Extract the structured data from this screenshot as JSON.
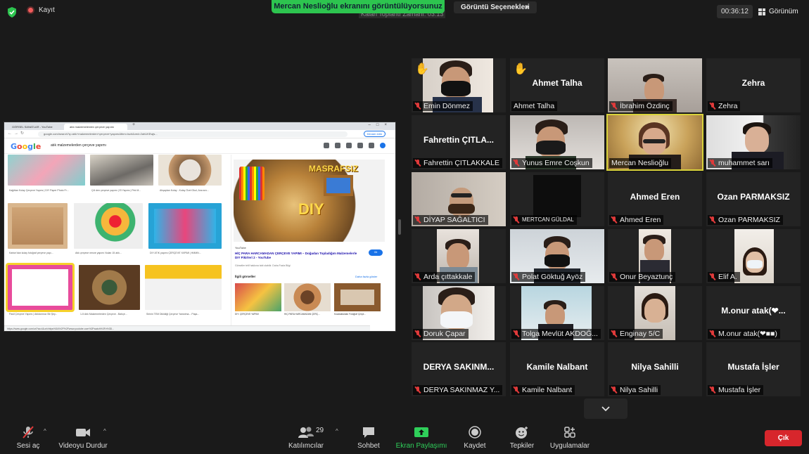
{
  "topbar": {
    "record_label": "Kayıt",
    "share_banner": "Mercan Neslioğlu ekranını görüntülüyorsunuz",
    "remaining_time": "Kalan Toplantı Zamanı: 03:13",
    "view_options_label": "Görüntü Seçenekleri",
    "timer": "00:36:12",
    "view_label": "Görünüm"
  },
  "shared_screen": {
    "browser_tabs": [
      "GÖRSEL SANATLAR - YouTube",
      "atık malzemelerden çerçeve yapımı"
    ],
    "url": "google.com/search?q=atık+malzemelerden+çerçeve+yapımı&tbm=isch&ved=2ahUKEwjs...",
    "continue_label": "Devam edin",
    "google_logo": "Google",
    "search_query": "atık malzemelerden çerçeve yapımı",
    "thumb_captions": [
      "Kağıttan Kolay Çerçeve Yapımı | DIY Paper Photo Fr...",
      "Çöl den çerçeve yapımı | El Yapımı | Pek M...",
      "Ahşaptan Kolay - Kolay Özel Okul, Ana sını...",
      "Karton'dan kolay fotoğraf çerçeve yapı...",
      "Atık çerçeve nesne yapımı Nolan 15 atık...",
      "DIY ATIK yapımı ÇERÇEVE YAPIMI | HMMN...",
      "Pasil Çerçeve Yapımı | Atıklarımızı Bir Şey...",
      "1-5 Atık Malzemelerden Çerçeve - Bahçe...",
      "Sirinin TEM Dikildiği Çerçeve Yansıtma... Paşa..."
    ],
    "panel_source": "YouTube",
    "panel_title": "HİÇ PARA HARCAMADAN ÇERÇEVE YAPIMI – Doğadan Topladığım Malzemelerle DIY Fikirleri 2 - YouTube",
    "panel_note": "Görseller telif hakkına tabi olabilir. Daha Fazla Bilgi",
    "visit_label": "Git",
    "related_label": "İlgili görseller",
    "related_more": "Daha fazla göster",
    "related_captions": [
      "DIY: ÇERÇEVE YAPIMI",
      "HİÇ PARA HARCAMADAN ÇERÇ...",
      "Kozalaklardan Fotoğraf Çerçe..."
    ],
    "image_text_big": "DIY",
    "image_text_top": "MASRAFSIZ",
    "status_url": "https://www.google.com/url?sa=i&url=https%3A%2F%2Fwww.youtube.com%2Fwatch%3Fv%3D..."
  },
  "participants": [
    {
      "name": "Emin Dönmez",
      "video": true,
      "hand": "yellow"
    },
    {
      "name": "Ahmet Talha",
      "big": "Ahmet Talha",
      "video": false,
      "hand": "white"
    },
    {
      "name": "İbrahim Özdinç",
      "video": true
    },
    {
      "name": "Zehra",
      "big": "Zehra",
      "video": false
    },
    {
      "name": "Fahrettin ÇITLAKKALE",
      "big": "Fahrettin ÇITLA...",
      "video": false
    },
    {
      "name": "Yunus Emre Coşkun",
      "video": true
    },
    {
      "name": "Mercan Neslioğlu",
      "video": true,
      "active": true
    },
    {
      "name": "muhammet sarı",
      "video": true
    },
    {
      "name": "DİYAP SAĞALTICI",
      "video": true
    },
    {
      "name": "MERTCAN GÜLDAL",
      "video": true
    },
    {
      "name": "Ahmed Eren",
      "big": "Ahmed Eren",
      "video": false
    },
    {
      "name": "Ozan PARMAKSIZ",
      "big": "Ozan PARMAKSIZ",
      "video": false
    },
    {
      "name": "Arda çıttakkale",
      "video": true
    },
    {
      "name": "Polat Göktuğ Ayöz",
      "video": true
    },
    {
      "name": "Onur Beyaztunç",
      "video": true
    },
    {
      "name": "Elif A.",
      "video": true
    },
    {
      "name": "Doruk Çapar",
      "video": true
    },
    {
      "name": "Tolga Mevlüt AKDOĞ...",
      "video": true
    },
    {
      "name": "Enginay 5/C",
      "video": true
    },
    {
      "name": "M.onur atak(❤■■)",
      "big": "M.onur atak(❤...",
      "video": false
    },
    {
      "name": "DERYA SAKINMAZ Y...",
      "big": "DERYA SAKINM...",
      "video": false
    },
    {
      "name": "Kamile Nalbant",
      "big": "Kamile Nalbant",
      "video": false
    },
    {
      "name": "Nilya Sahilli",
      "big": "Nilya Sahilli",
      "video": false
    },
    {
      "name": "Mustafa İşler",
      "big": "Mustafa İşler",
      "video": false
    }
  ],
  "more_button": "⌄",
  "toolbar": {
    "mute": "Sesi aç",
    "video": "Videoyu Durdur",
    "participants": "Katılımcılar",
    "participant_count": "29",
    "chat": "Sohbet",
    "share": "Ekran Paylaşımı",
    "record": "Kaydet",
    "reactions": "Tepkiler",
    "apps": "Uygulamalar",
    "exit": "Çık"
  },
  "colors": {
    "accent_green": "#2dc44f",
    "exit_red": "#d7262c",
    "active_speaker": "#d8d23a",
    "mic_muted": "#e03a3a"
  }
}
